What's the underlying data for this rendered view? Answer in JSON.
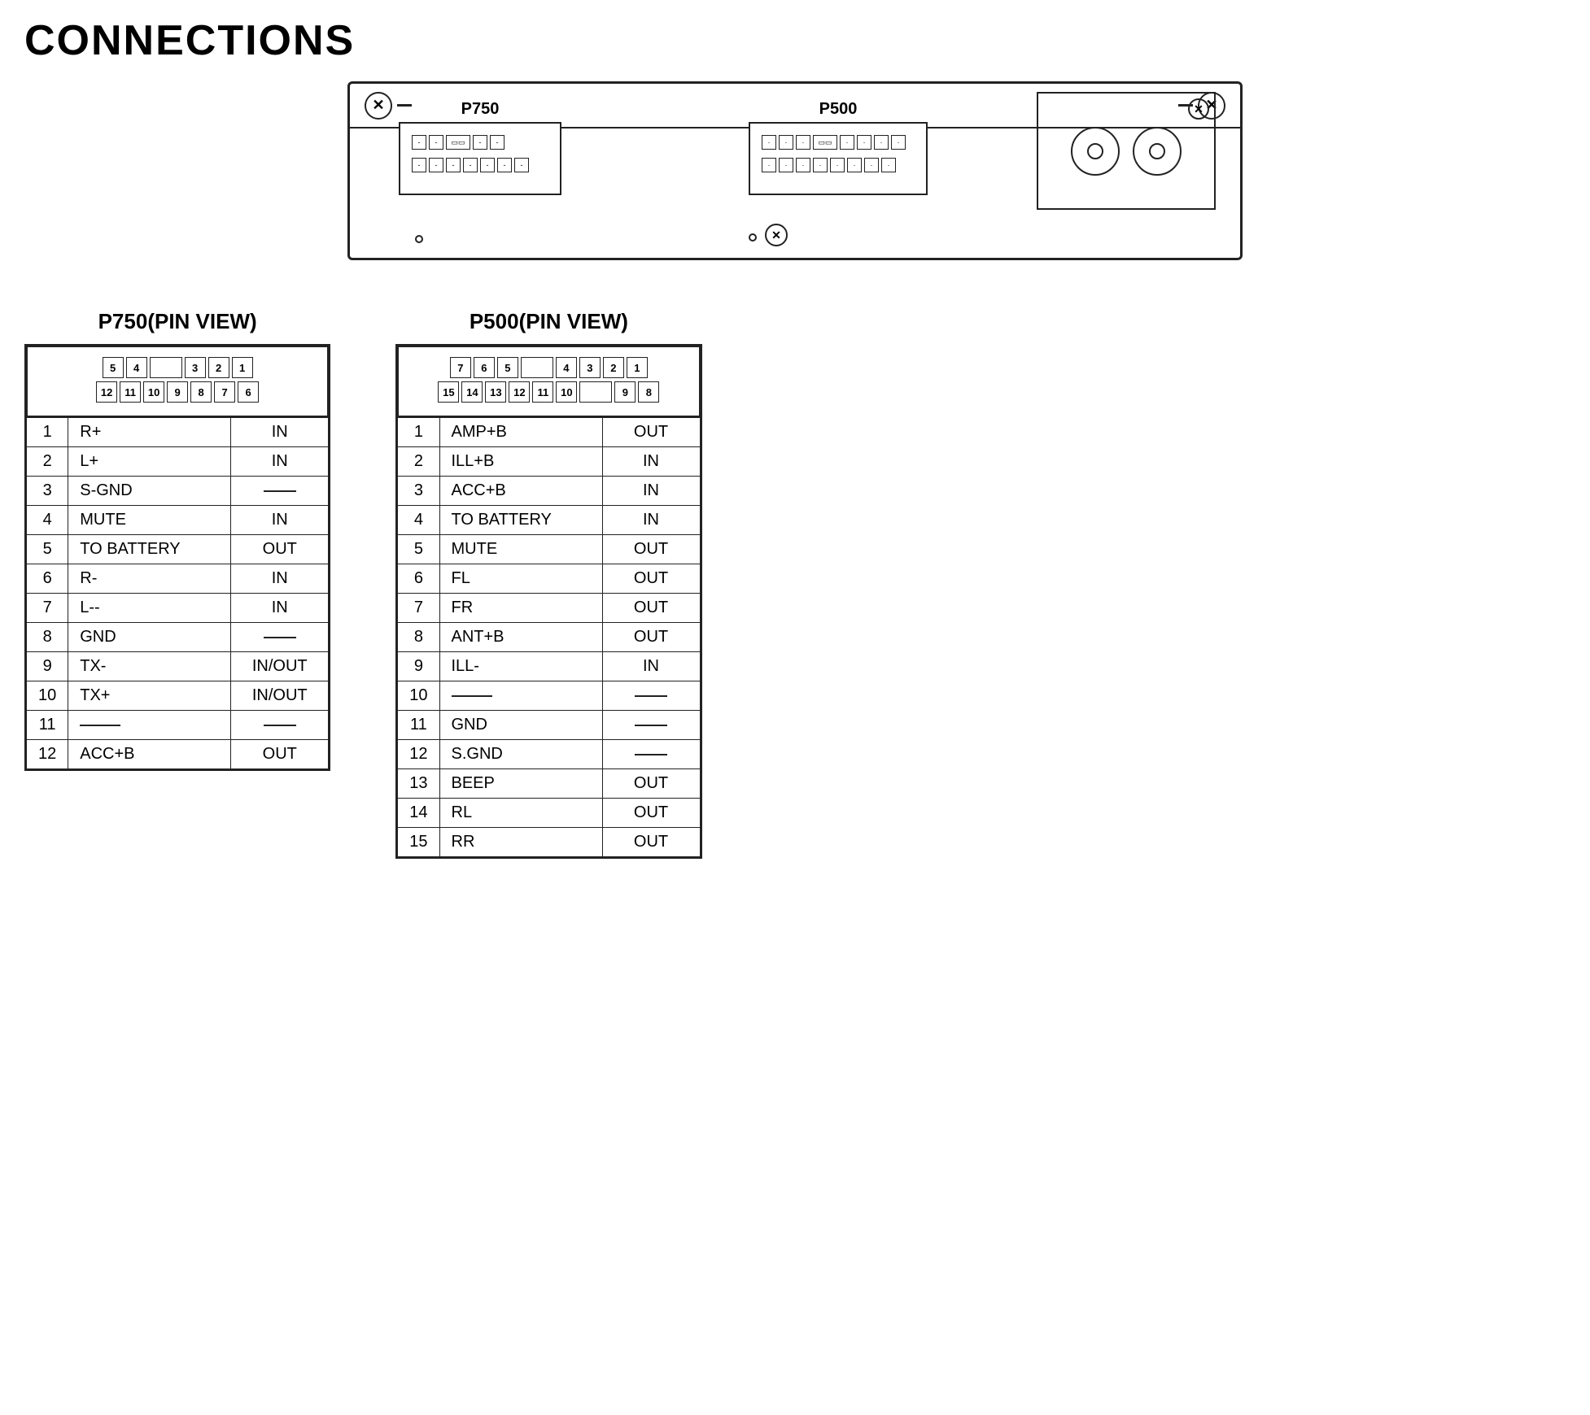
{
  "title": "CONNECTIONS",
  "device": {
    "p750_label": "P750",
    "p500_label": "P500"
  },
  "p750": {
    "title": "P750(PIN VIEW)",
    "top_row": [
      "5",
      "4",
      "",
      "",
      "",
      "3",
      "2",
      "1"
    ],
    "bottom_row": [
      "12",
      "11",
      "10",
      "9",
      "8",
      "7",
      "6"
    ],
    "pins": [
      {
        "num": "1",
        "name": "R+",
        "dir": "IN"
      },
      {
        "num": "2",
        "name": "L+",
        "dir": "IN"
      },
      {
        "num": "3",
        "name": "S-GND",
        "dir": "—"
      },
      {
        "num": "4",
        "name": "MUTE",
        "dir": "IN"
      },
      {
        "num": "5",
        "name": "TO BATTERY",
        "dir": "OUT"
      },
      {
        "num": "6",
        "name": "R-",
        "dir": "IN"
      },
      {
        "num": "7",
        "name": "L--",
        "dir": "IN"
      },
      {
        "num": "8",
        "name": "GND",
        "dir": "—"
      },
      {
        "num": "9",
        "name": "TX-",
        "dir": "IN/OUT"
      },
      {
        "num": "10",
        "name": "TX+",
        "dir": "IN/OUT"
      },
      {
        "num": "11",
        "name": "—",
        "dir": "—"
      },
      {
        "num": "12",
        "name": "ACC+B",
        "dir": "OUT"
      }
    ]
  },
  "p500": {
    "title": "P500(PIN VIEW)",
    "top_row": [
      "7",
      "6",
      "5",
      "",
      "",
      "4",
      "3",
      "2",
      "1"
    ],
    "bottom_row": [
      "15",
      "14",
      "",
      "13",
      "12",
      "11",
      "10",
      "",
      "9",
      "8"
    ],
    "pins": [
      {
        "num": "1",
        "name": "AMP+B",
        "dir": "OUT"
      },
      {
        "num": "2",
        "name": "ILL+B",
        "dir": "IN"
      },
      {
        "num": "3",
        "name": "ACC+B",
        "dir": "IN"
      },
      {
        "num": "4",
        "name": "TO BATTERY",
        "dir": "IN"
      },
      {
        "num": "5",
        "name": "MUTE",
        "dir": "OUT"
      },
      {
        "num": "6",
        "name": "FL",
        "dir": "OUT"
      },
      {
        "num": "7",
        "name": "FR",
        "dir": "OUT"
      },
      {
        "num": "8",
        "name": "ANT+B",
        "dir": "OUT"
      },
      {
        "num": "9",
        "name": "ILL-",
        "dir": "IN"
      },
      {
        "num": "10",
        "name": "—",
        "dir": "—"
      },
      {
        "num": "11",
        "name": "GND",
        "dir": "—"
      },
      {
        "num": "12",
        "name": "S.GND",
        "dir": "—"
      },
      {
        "num": "13",
        "name": "BEEP",
        "dir": "OUT"
      },
      {
        "num": "14",
        "name": "RL",
        "dir": "OUT"
      },
      {
        "num": "15",
        "name": "RR",
        "dir": "OUT"
      }
    ]
  }
}
